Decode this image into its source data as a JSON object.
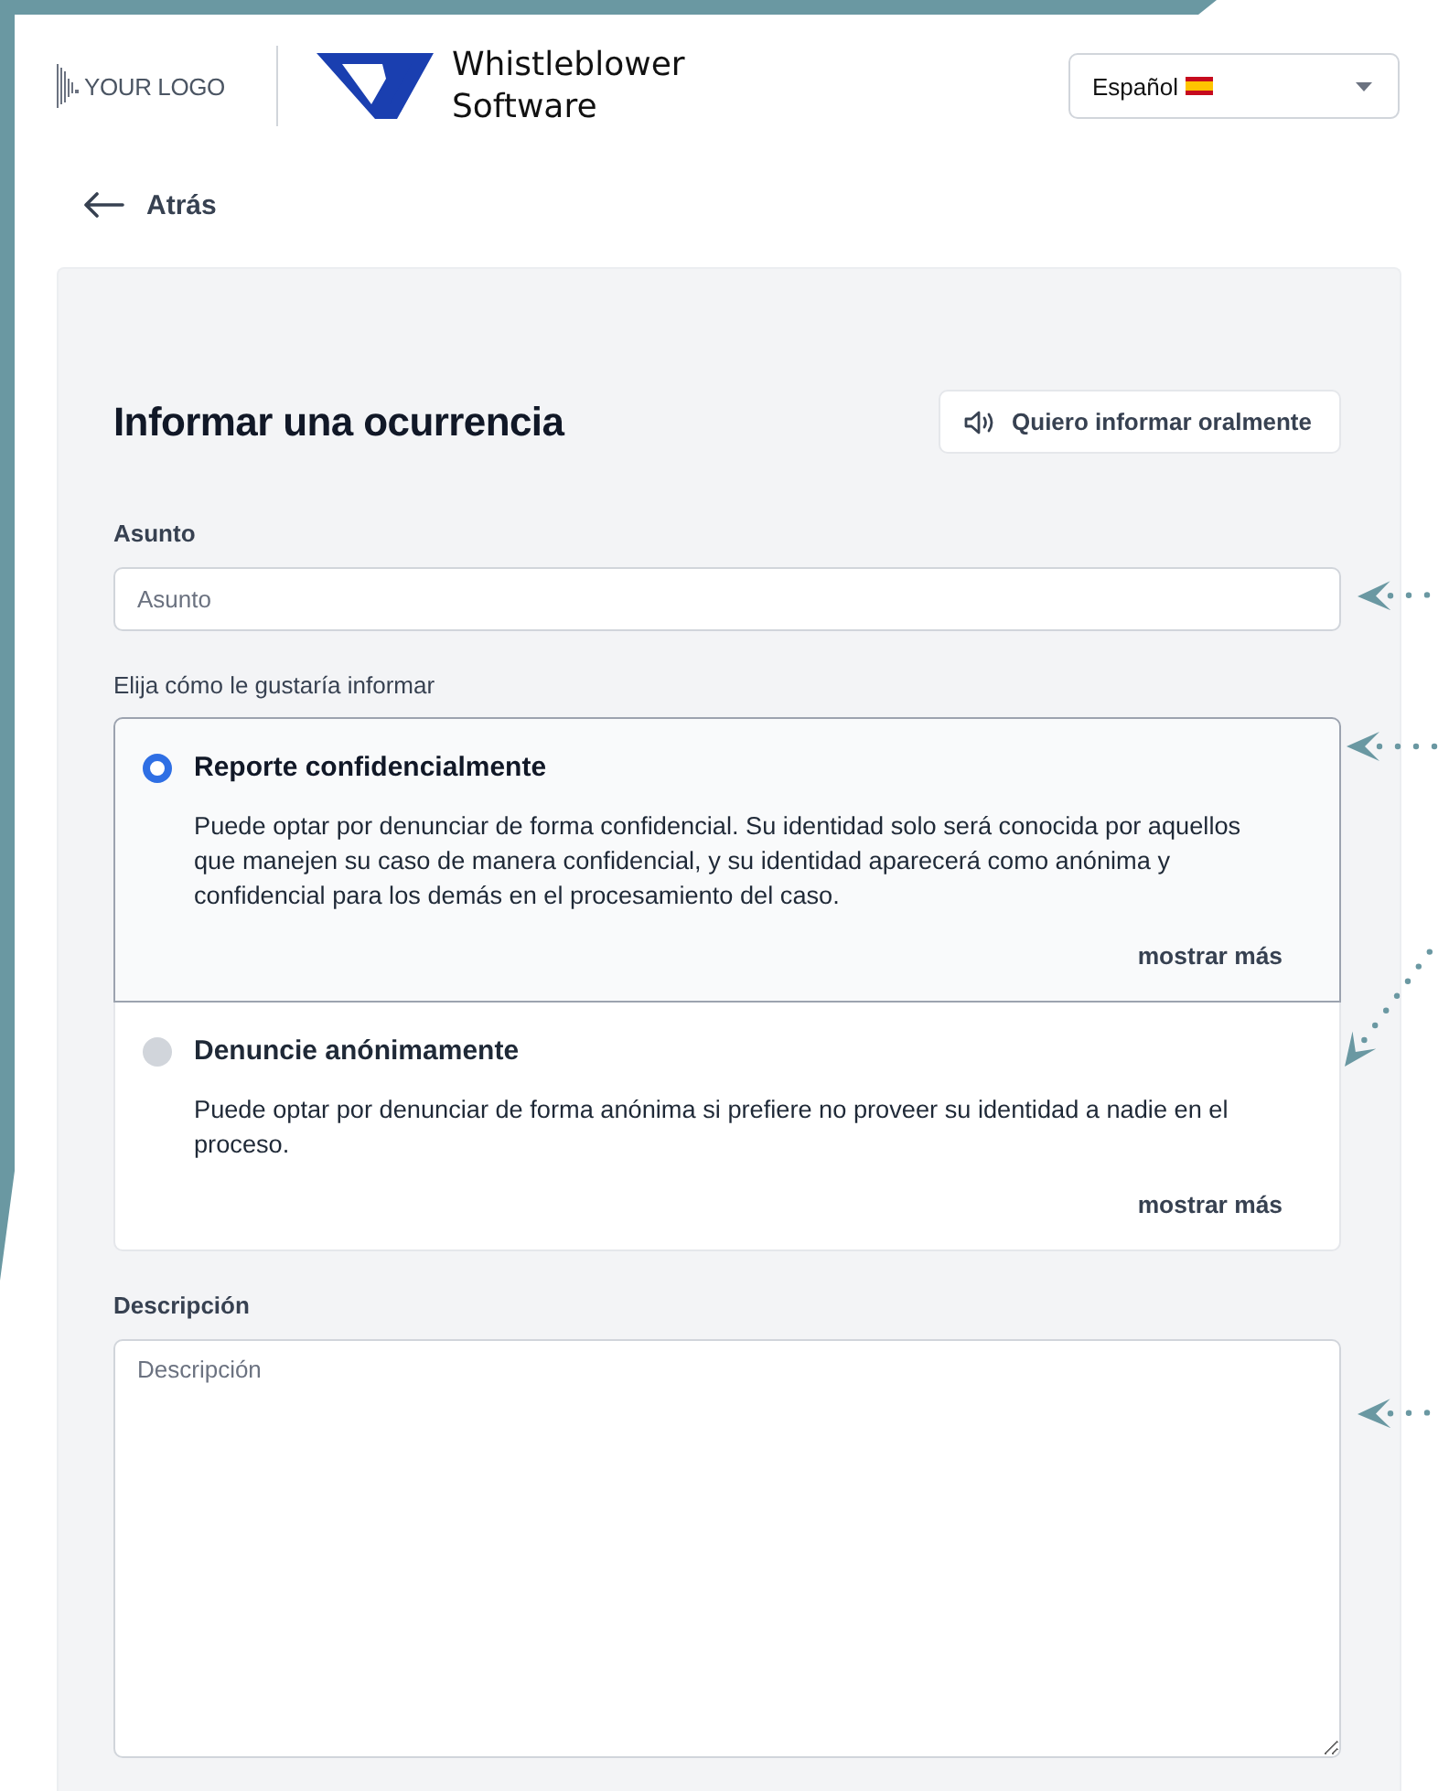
{
  "header": {
    "client_logo": "YOUR LOGO",
    "brand_name": [
      "Whistleblower",
      "Software"
    ],
    "language": {
      "value": "Español"
    }
  },
  "back_link": "Atrás",
  "form": {
    "title": "Informar una ocurrencia",
    "oral_button": "Quiero informar oralmente",
    "subject": {
      "label": "Asunto",
      "placeholder": "Asunto"
    },
    "reporting_label": "Elija cómo le gustaría informar",
    "options": [
      {
        "title": "Reporte confidencialmente",
        "description": "Puede optar por denunciar de forma confidencial. Su identidad solo será conocida por aquellos que manejen su caso de manera confidencial, y su identidad aparecerá como anónima y confidencial para los demás en el procesamiento del caso.",
        "more": "mostrar más",
        "selected": true
      },
      {
        "title": "Denuncie anónimamente",
        "description": "Puede optar por denunciar de forma anónima si prefiere no proveer su identidad a nadie en el proceso.",
        "more": "mostrar más",
        "selected": false
      }
    ],
    "description": {
      "label": "Descripción",
      "placeholder": "Descripción"
    }
  }
}
